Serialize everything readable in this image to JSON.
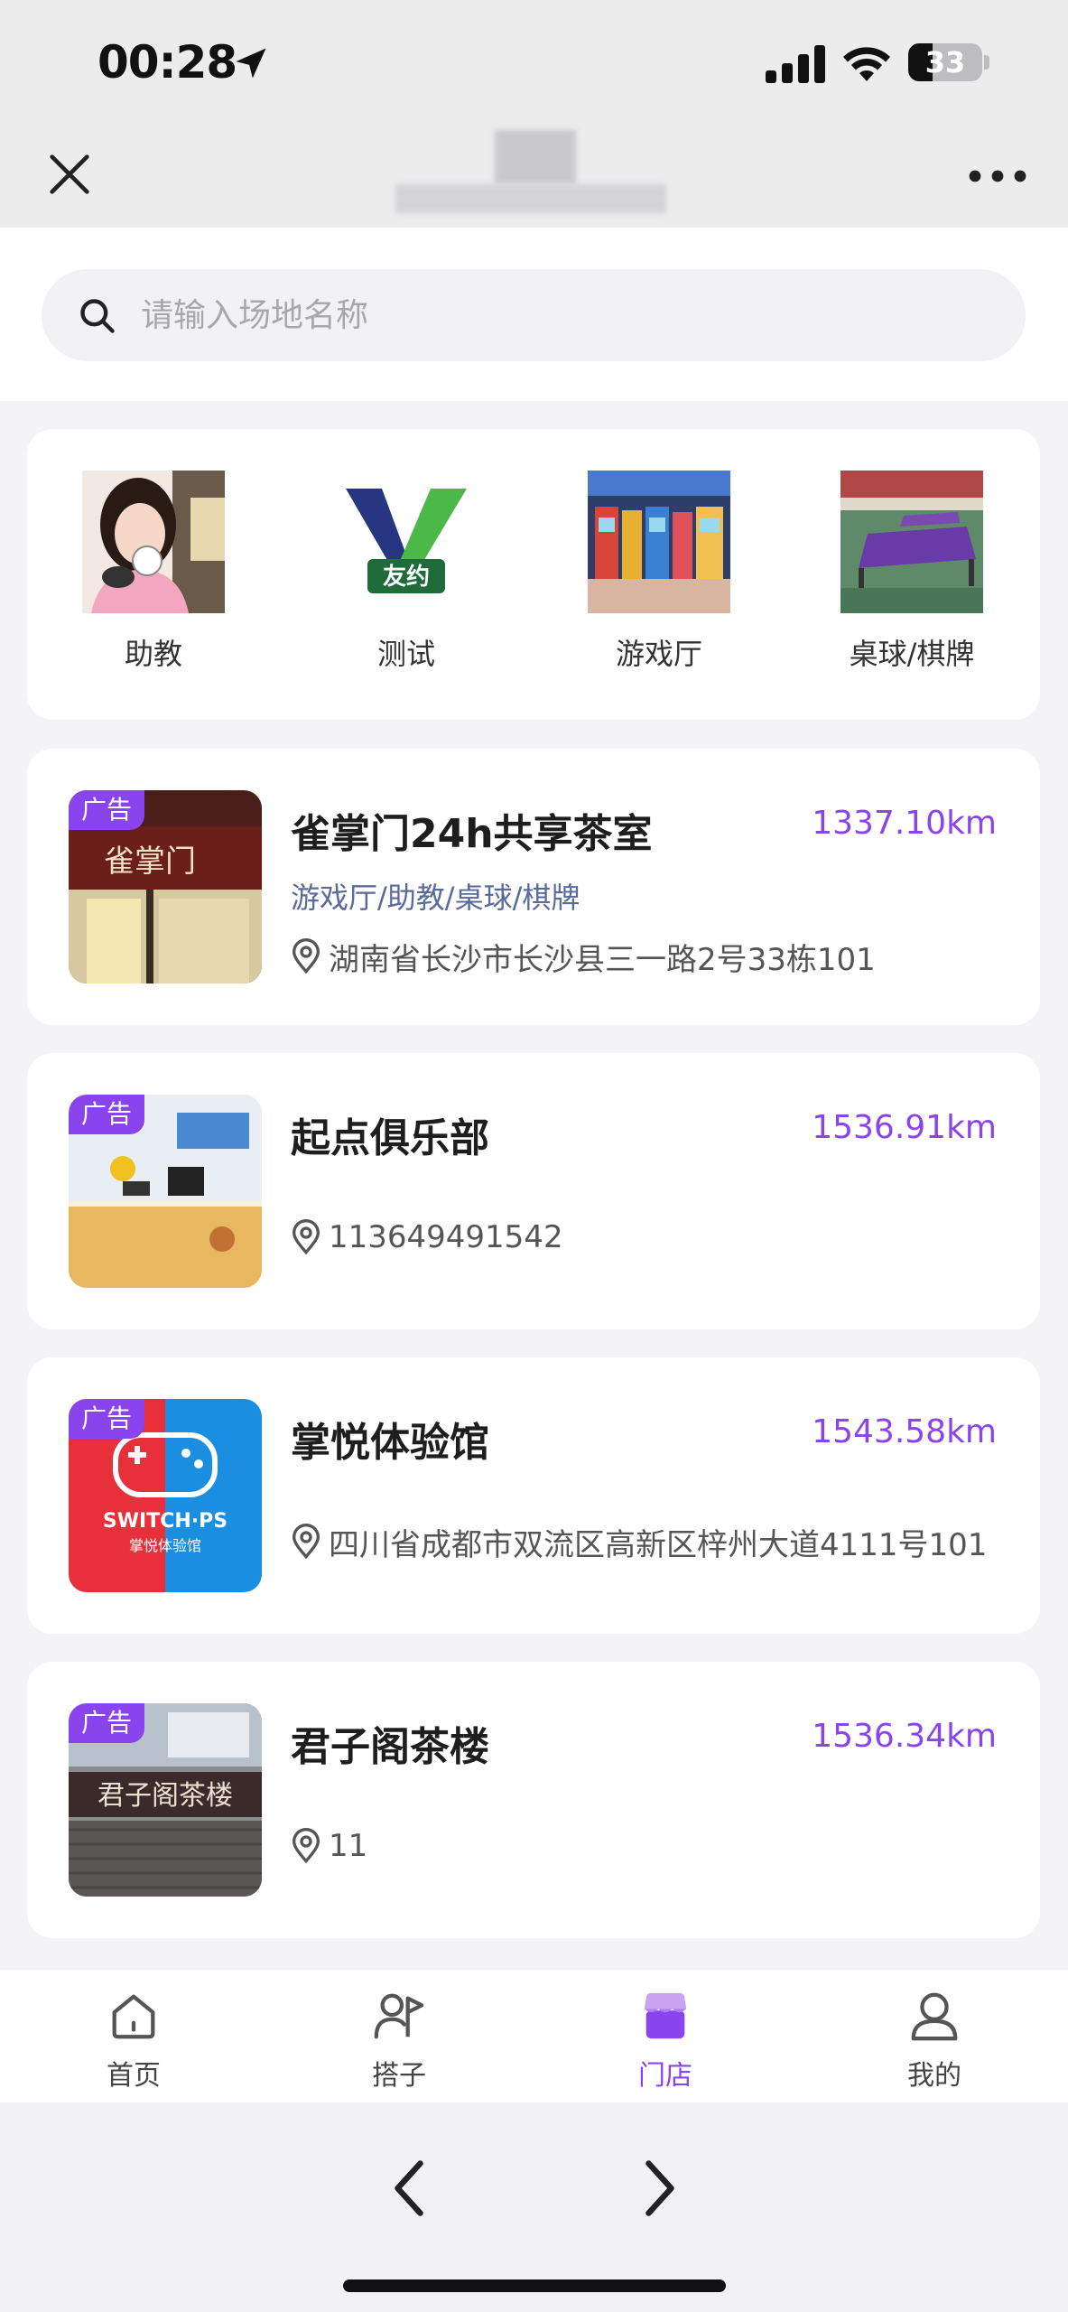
{
  "status_bar": {
    "time": "00:28",
    "battery": "33",
    "battery_level": 0.33
  },
  "title_bar": {
    "title": ""
  },
  "search": {
    "placeholder": "请输入场地名称"
  },
  "categories": [
    {
      "label": "助教",
      "icon": "assistant-photo"
    },
    {
      "label": "测试",
      "icon": "youyue-logo"
    },
    {
      "label": "游戏厅",
      "icon": "arcade-photo"
    },
    {
      "label": "桌球/棋牌",
      "icon": "billiards-photo"
    }
  ],
  "stores": [
    {
      "badge": "广告",
      "name": "雀掌门24h共享茶室",
      "distance": "1337.10km",
      "tags": "游戏厅/助教/桌球/棋牌",
      "address": "湖南省长沙市长沙县三一路2号33栋101",
      "thumb_text": "雀掌门"
    },
    {
      "badge": "广告",
      "name": "起点俱乐部",
      "distance": "1536.91km",
      "tags": "",
      "address": "113649491542",
      "thumb_text": ""
    },
    {
      "badge": "广告",
      "name": "掌悦体验馆",
      "distance": "1543.58km",
      "tags": "",
      "address": "四川省成都市双流区高新区梓州大道4111号101",
      "thumb_text": "SWITCH·PS",
      "thumb_subtext": "掌悦体验馆"
    },
    {
      "badge": "广告",
      "name": "君子阁茶楼",
      "distance": "1536.34km",
      "tags": "",
      "address": "11",
      "thumb_text": "君子阁茶楼"
    }
  ],
  "tabs": [
    {
      "label": "首页",
      "icon": "home-icon",
      "active": false
    },
    {
      "label": "搭子",
      "icon": "partner-icon",
      "active": false
    },
    {
      "label": "门店",
      "icon": "store-icon",
      "active": true
    },
    {
      "label": "我的",
      "icon": "profile-icon",
      "active": false
    }
  ],
  "colors": {
    "accent": "#8a44ee",
    "tag_text": "#5a6a9a",
    "background": "#f4f4f6"
  }
}
